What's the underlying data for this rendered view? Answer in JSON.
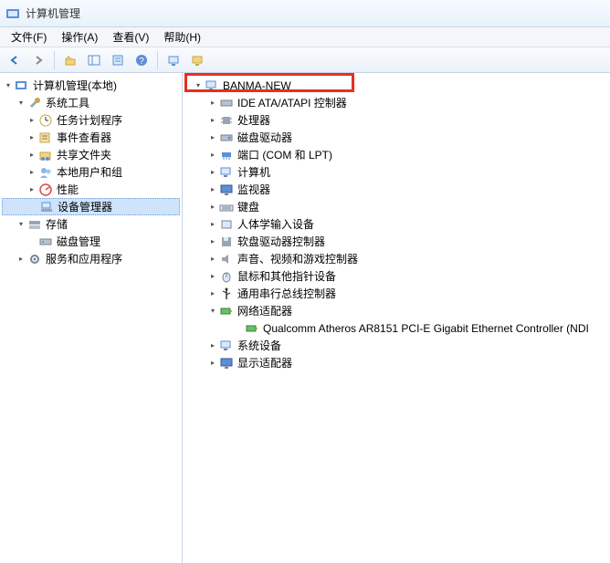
{
  "window": {
    "title": "计算机管理"
  },
  "menu": {
    "file": "文件(F)",
    "action": "操作(A)",
    "view": "查看(V)",
    "help": "帮助(H)"
  },
  "leftTree": {
    "root": "计算机管理(本地)",
    "systemTools": "系统工具",
    "taskScheduler": "任务计划程序",
    "eventViewer": "事件查看器",
    "sharedFolders": "共享文件夹",
    "localUsersGroups": "本地用户和组",
    "performance": "性能",
    "deviceManager": "设备管理器",
    "storage": "存储",
    "diskManagement": "磁盘管理",
    "servicesApps": "服务和应用程序"
  },
  "rightTree": {
    "root": "BANMA-NEW",
    "ide": "IDE ATA/ATAPI 控制器",
    "processors": "处理器",
    "diskDrives": "磁盘驱动器",
    "ports": "端口 (COM 和 LPT)",
    "computer": "计算机",
    "monitors": "监视器",
    "keyboards": "键盘",
    "hid": "人体学输入设备",
    "floppyControllers": "软盘驱动器控制器",
    "sound": "声音、视频和游戏控制器",
    "mice": "鼠标和其他指针设备",
    "usb": "通用串行总线控制器",
    "networkAdapters": "网络适配器",
    "networkAdapter1": "Qualcomm Atheros AR8151 PCI-E Gigabit Ethernet Controller (NDI",
    "systemDevices": "系统设备",
    "displayAdapters": "显示适配器"
  }
}
